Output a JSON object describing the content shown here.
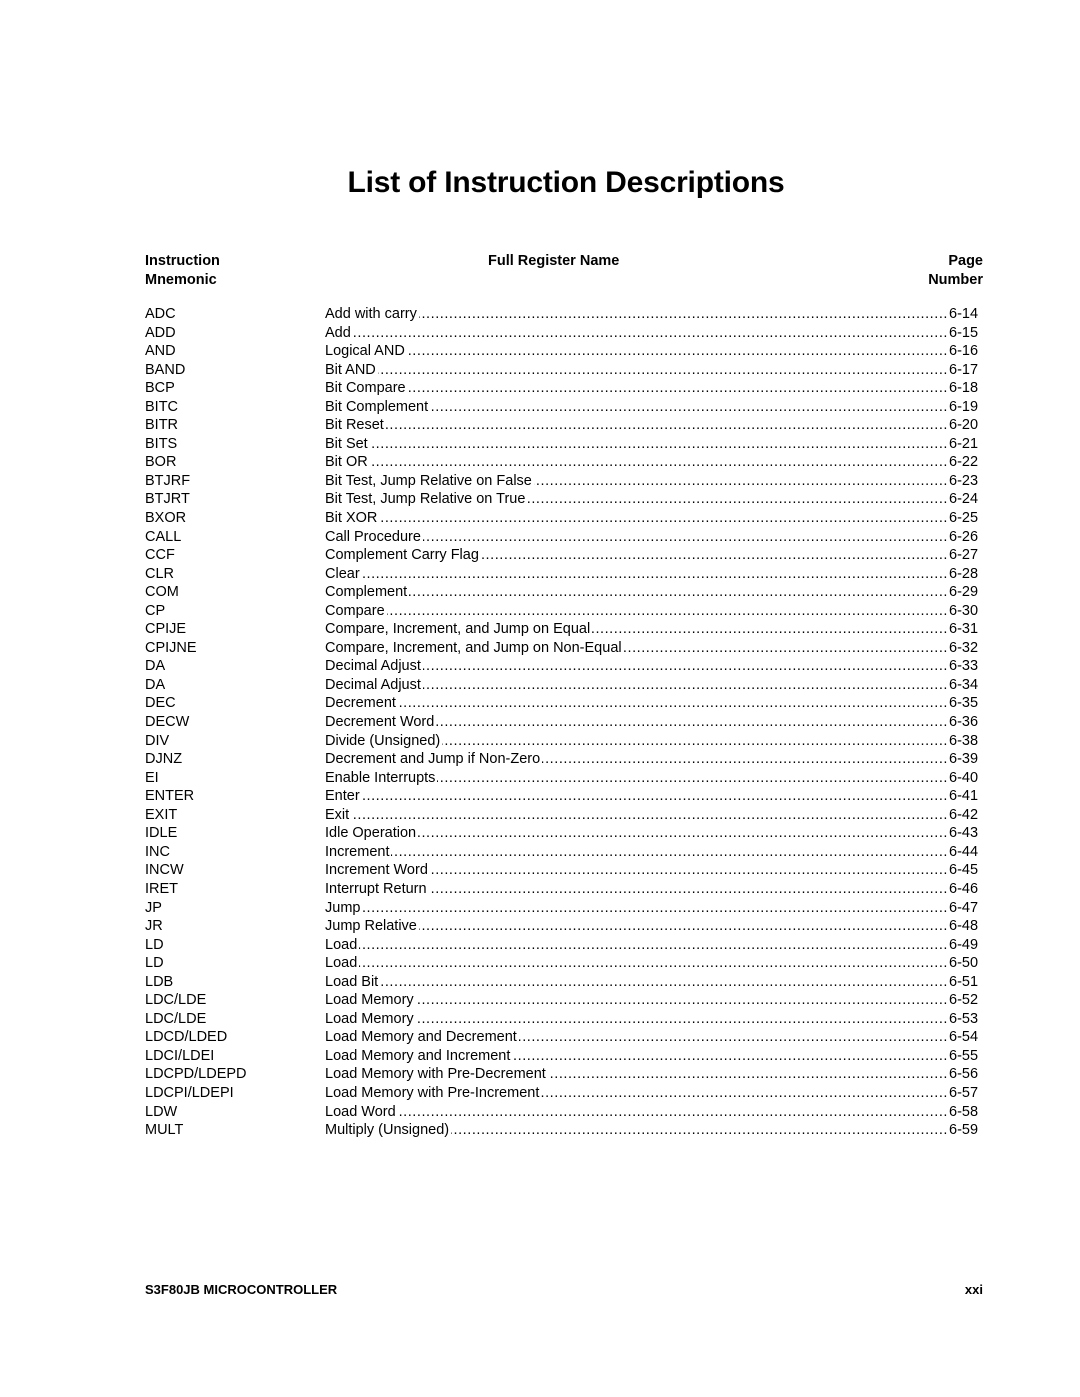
{
  "page": {
    "title": "List of Instruction Descriptions"
  },
  "headers": {
    "mnemonic_line1": "Instruction",
    "mnemonic_line2": "Mnemonic",
    "name": "Full Register Name",
    "page_line1": "Page",
    "page_line2": "Number"
  },
  "entries": [
    {
      "mnemonic": "ADC",
      "name": "Add with carry",
      "page": "6-14"
    },
    {
      "mnemonic": "ADD",
      "name": "Add",
      "page": "6-15"
    },
    {
      "mnemonic": "AND",
      "name": "Logical AND",
      "page": "6-16"
    },
    {
      "mnemonic": "BAND",
      "name": "Bit AND",
      "page": "6-17"
    },
    {
      "mnemonic": "BCP",
      "name": "Bit Compare",
      "page": "6-18"
    },
    {
      "mnemonic": "BITC",
      "name": "Bit Complement",
      "page": "6-19"
    },
    {
      "mnemonic": "BITR",
      "name": "Bit Reset",
      "page": "6-20"
    },
    {
      "mnemonic": "BITS",
      "name": "Bit Set",
      "page": "6-21"
    },
    {
      "mnemonic": "BOR",
      "name": "Bit OR",
      "page": "6-22"
    },
    {
      "mnemonic": "BTJRF",
      "name": "Bit Test, Jump Relative on False",
      "page": "6-23"
    },
    {
      "mnemonic": "BTJRT",
      "name": "Bit Test, Jump Relative on True",
      "page": "6-24"
    },
    {
      "mnemonic": "BXOR",
      "name": "Bit XOR",
      "page": "6-25"
    },
    {
      "mnemonic": "CALL",
      "name": "Call Procedure",
      "page": "6-26"
    },
    {
      "mnemonic": "CCF",
      "name": "Complement Carry Flag",
      "page": "6-27"
    },
    {
      "mnemonic": "CLR",
      "name": "Clear",
      "page": "6-28"
    },
    {
      "mnemonic": "COM",
      "name": "Complement",
      "page": "6-29"
    },
    {
      "mnemonic": "CP",
      "name": "Compare",
      "page": "6-30"
    },
    {
      "mnemonic": "CPIJE",
      "name": "Compare, Increment, and Jump on Equal",
      "page": "6-31"
    },
    {
      "mnemonic": "CPIJNE",
      "name": "Compare, Increment, and Jump on Non-Equal",
      "page": "6-32"
    },
    {
      "mnemonic": "DA",
      "name": "Decimal Adjust",
      "page": "6-33"
    },
    {
      "mnemonic": "DA",
      "name": "Decimal Adjust",
      "page": "6-34"
    },
    {
      "mnemonic": "DEC",
      "name": "Decrement",
      "page": "6-35"
    },
    {
      "mnemonic": "DECW",
      "name": "Decrement Word",
      "page": "6-36"
    },
    {
      "mnemonic": "DIV",
      "name": "Divide (Unsigned)",
      "page": "6-38"
    },
    {
      "mnemonic": "DJNZ",
      "name": "Decrement and Jump if Non-Zero",
      "page": "6-39"
    },
    {
      "mnemonic": "EI",
      "name": "Enable Interrupts",
      "page": "6-40"
    },
    {
      "mnemonic": "ENTER",
      "name": "Enter",
      "page": "6-41"
    },
    {
      "mnemonic": "EXIT",
      "name": "Exit",
      "page": "6-42"
    },
    {
      "mnemonic": "IDLE",
      "name": "Idle Operation",
      "page": "6-43"
    },
    {
      "mnemonic": "INC",
      "name": "Increment",
      "page": "6-44"
    },
    {
      "mnemonic": "INCW",
      "name": "Increment Word",
      "page": "6-45"
    },
    {
      "mnemonic": "IRET",
      "name": "Interrupt Return",
      "page": "6-46"
    },
    {
      "mnemonic": "JP",
      "name": "Jump",
      "page": "6-47"
    },
    {
      "mnemonic": "JR",
      "name": "Jump Relative",
      "page": "6-48"
    },
    {
      "mnemonic": "LD",
      "name": "Load",
      "page": "6-49"
    },
    {
      "mnemonic": "LD",
      "name": "Load",
      "page": "6-50"
    },
    {
      "mnemonic": "LDB",
      "name": "Load Bit",
      "page": "6-51"
    },
    {
      "mnemonic": "LDC/LDE",
      "name": "Load Memory",
      "page": "6-52"
    },
    {
      "mnemonic": "LDC/LDE",
      "name": "Load Memory",
      "page": "6-53"
    },
    {
      "mnemonic": "LDCD/LDED",
      "name": "Load Memory and Decrement",
      "page": "6-54"
    },
    {
      "mnemonic": "LDCI/LDEI",
      "name": "Load Memory and Increment",
      "page": "6-55"
    },
    {
      "mnemonic": "LDCPD/LDEPD",
      "name": "Load Memory with Pre-Decrement",
      "page": "6-56"
    },
    {
      "mnemonic": "LDCPI/LDEPI",
      "name": "Load Memory with Pre-Increment",
      "page": "6-57"
    },
    {
      "mnemonic": "LDW",
      "name": "Load Word",
      "page": "6-58"
    },
    {
      "mnemonic": "MULT",
      "name": "Multiply (Unsigned)",
      "page": "6-59"
    }
  ],
  "footer": {
    "product": "S3F80JB MICROCONTROLLER",
    "page_number": "xxi"
  }
}
